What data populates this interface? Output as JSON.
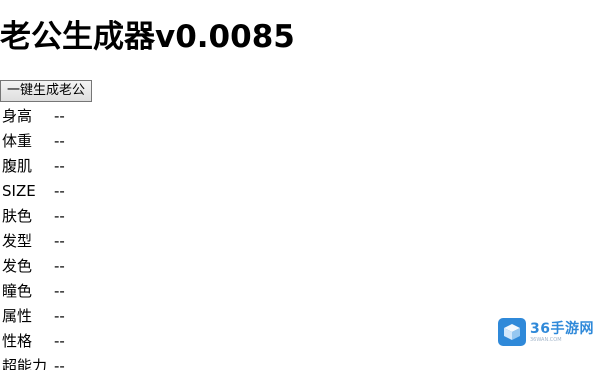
{
  "page": {
    "title": "老公生成器v0.0085"
  },
  "controls": {
    "generate_label": "一键生成老公"
  },
  "attributes": [
    {
      "label": "身高",
      "value": "--"
    },
    {
      "label": "体重",
      "value": "--"
    },
    {
      "label": "腹肌",
      "value": "--"
    },
    {
      "label": "SIZE",
      "value": "--"
    },
    {
      "label": "肤色",
      "value": "--"
    },
    {
      "label": "发型",
      "value": "--"
    },
    {
      "label": "发色",
      "value": "--"
    },
    {
      "label": "瞳色",
      "value": "--"
    },
    {
      "label": "属性",
      "value": "--"
    },
    {
      "label": "性格",
      "value": "--"
    },
    {
      "label": "超能力",
      "value": "--"
    }
  ],
  "watermark": {
    "text": "36手游网",
    "sub": "36WAN.COM",
    "accent_color": "#1e7fd6"
  }
}
